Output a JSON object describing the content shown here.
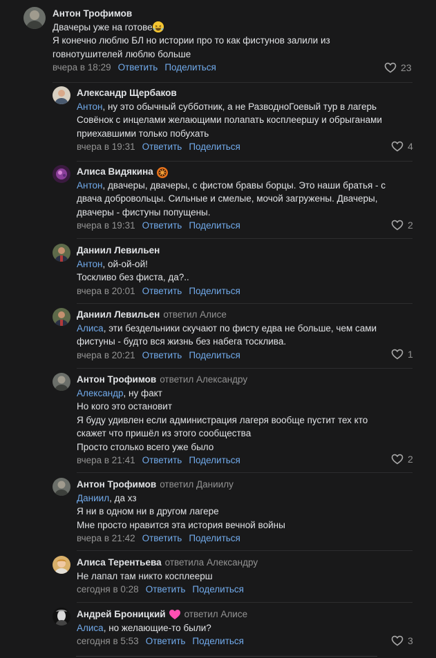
{
  "comments": [
    {
      "author": "Антон Трофимов",
      "reply_to": "",
      "mention": "",
      "lines": [
        "Двачеры уже на готове",
        "Я конечно люблю БЛ но истории про то как фистунов залили из",
        "говнотушителей люблю больше"
      ],
      "time": "вчера в 18:29",
      "reply_label": "Ответить",
      "share_label": "Поделиться",
      "likes": "23"
    },
    {
      "author": "Александр Щербаков",
      "reply_to": "",
      "mention": "Антон",
      "lines": [
        ", ну это обычный субботник, а не РазводноГоевый тур в лагерь",
        "Совёнок с инцелами желающими полапать косплеершу и обрыганами",
        "приехавшими только побухать"
      ],
      "time": "вчера в 19:31",
      "reply_label": "Ответить",
      "share_label": "Поделиться",
      "likes": "4"
    },
    {
      "author": "Алиса Видякина",
      "reply_to": "",
      "mention": "Антон",
      "lines": [
        ", двачеры, двачеры, с фистом бравы борцы. Это наши братья - с",
        "двача добровольцы. Сильные и смелые, мочой загружены. Двачеры,",
        "двачеры - фистуны попущены."
      ],
      "time": "вчера в 19:31",
      "reply_label": "Ответить",
      "share_label": "Поделиться",
      "likes": "2"
    },
    {
      "author": "Даниил Левильен",
      "reply_to": "",
      "mention": "Антон",
      "lines": [
        ", ой-ой-ой!",
        "Тоскливо без фиста, да?.."
      ],
      "time": "вчера в 20:01",
      "reply_label": "Ответить",
      "share_label": "Поделиться",
      "likes": ""
    },
    {
      "author": "Даниил Левильен",
      "reply_to": "ответил Алисе",
      "mention": "Алиса",
      "lines": [
        ", эти бездельники скучают по фисту едва не больше, чем сами",
        "фистуны - будто вся жизнь без набега тосклива."
      ],
      "time": "вчера в 20:21",
      "reply_label": "Ответить",
      "share_label": "Поделиться",
      "likes": "1"
    },
    {
      "author": "Антон Трофимов",
      "reply_to": "ответил Александру",
      "mention": "Александр",
      "lines": [
        ", ну факт",
        "Но кого это остановит",
        "Я буду удивлен если администрация лагеря вообще пустит тех кто",
        "скажет что пришёл из этого сообщества",
        "Просто столько всего уже было"
      ],
      "time": "вчера в 21:41",
      "reply_label": "Ответить",
      "share_label": "Поделиться",
      "likes": "2"
    },
    {
      "author": "Антон Трофимов",
      "reply_to": "ответил Даниилу",
      "mention": "Даниил",
      "lines": [
        ", да хз",
        "Я ни в одном ни в другом лагере",
        "Мне просто нравится эта история вечной войны"
      ],
      "time": "вчера в 21:42",
      "reply_label": "Ответить",
      "share_label": "Поделиться",
      "likes": ""
    },
    {
      "author": "Алиса Терентьева",
      "reply_to": "ответила Александру",
      "mention": "",
      "lines": [
        "Не лапал там никто косплеерш"
      ],
      "time": "сегодня в 0:28",
      "reply_label": "Ответить",
      "share_label": "Поделиться",
      "likes": ""
    },
    {
      "author": "Андрей Броницкий",
      "reply_to": "ответил Алисе",
      "mention": "Алиса",
      "lines": [
        ", но желающие-то были?"
      ],
      "time": "сегодня в 5:53",
      "reply_label": "Ответить",
      "share_label": "Поделиться",
      "likes": "3"
    }
  ],
  "colors": {
    "background": "#19191a",
    "link": "#71aaeb",
    "muted": "#939393",
    "text": "#e1e3e6"
  },
  "icons": {
    "like": "heart-outline-icon",
    "emoji": "laughing-emoji-icon",
    "author_badge_1": "sun-badge-icon",
    "author_badge_2": "pink-heart-icon"
  }
}
